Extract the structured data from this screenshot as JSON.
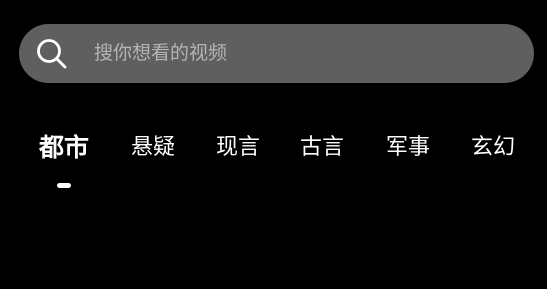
{
  "search": {
    "placeholder": "搜你想看的视频",
    "icon": "search-icon"
  },
  "tabs": [
    {
      "label": "都市",
      "active": true
    },
    {
      "label": "悬疑",
      "active": false
    },
    {
      "label": "现言",
      "active": false
    },
    {
      "label": "古言",
      "active": false
    },
    {
      "label": "军事",
      "active": false
    },
    {
      "label": "玄幻",
      "active": false
    }
  ],
  "colors": {
    "background": "#000000",
    "search_bar": "#5f5f5f",
    "text": "#ffffff",
    "placeholder": "#b4b4b4"
  }
}
